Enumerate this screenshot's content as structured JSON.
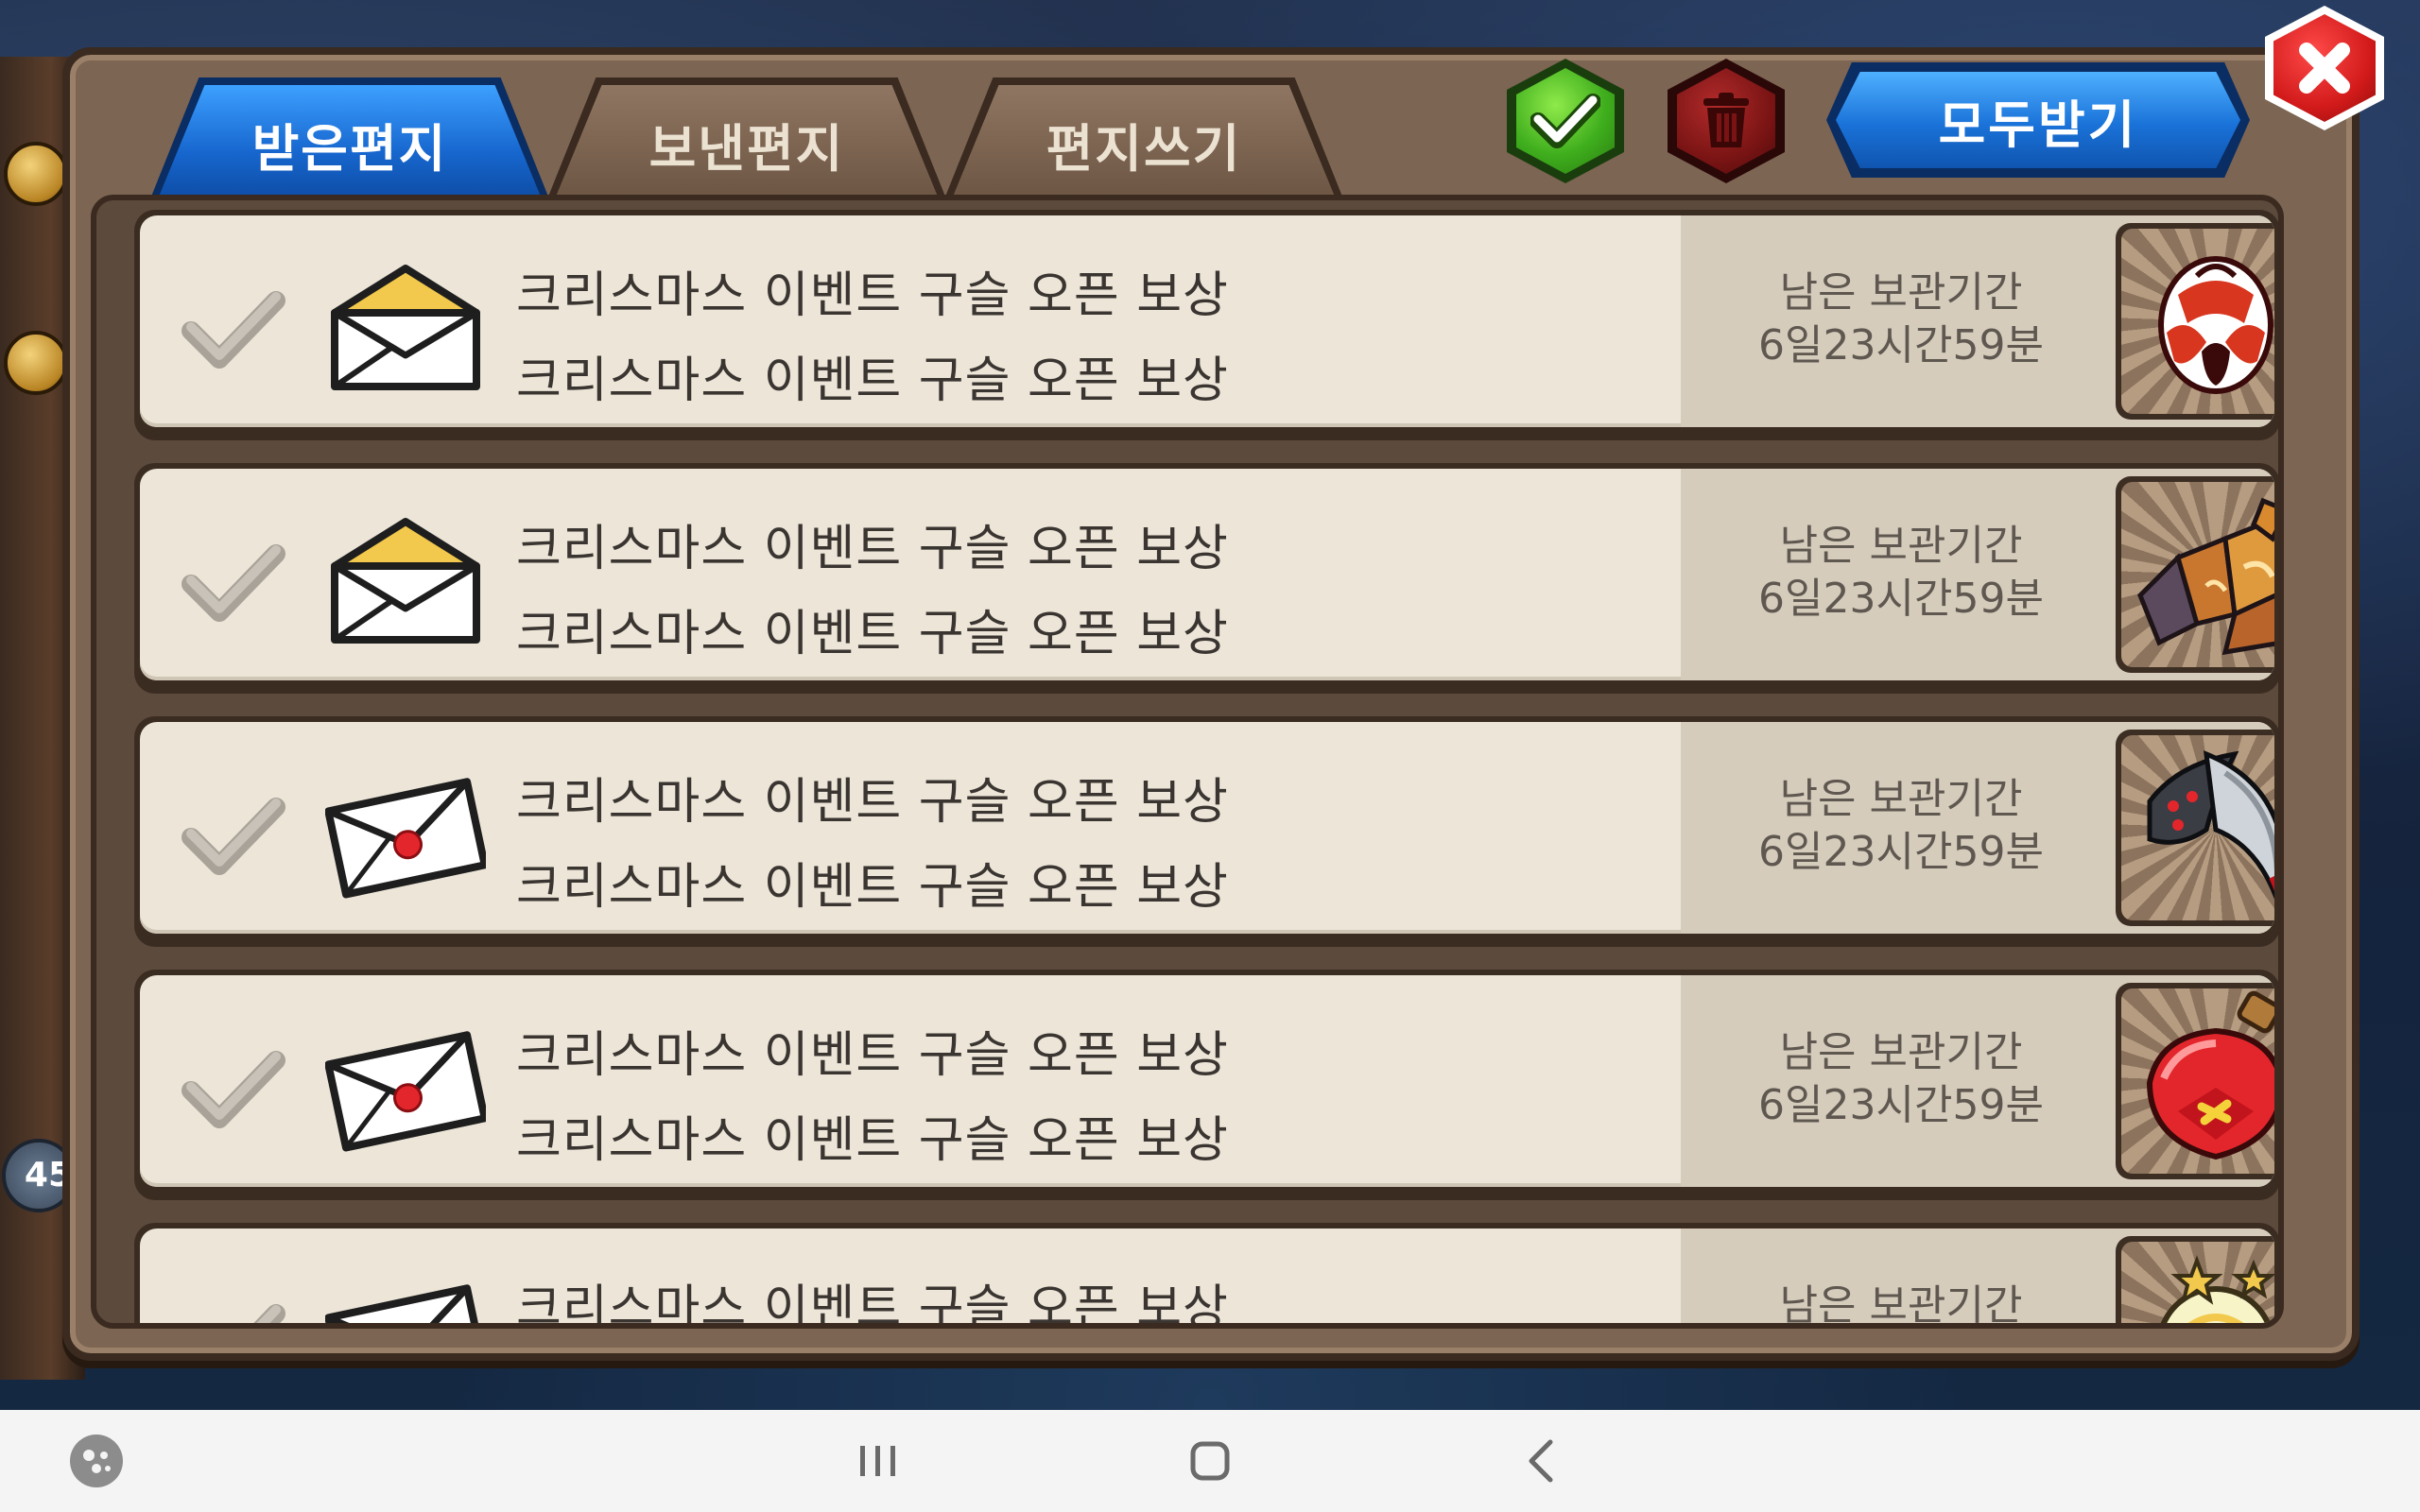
{
  "game_bg": {
    "level_badge": "45"
  },
  "tabs": [
    {
      "label": "받은편지",
      "active": true
    },
    {
      "label": "보낸편지",
      "active": false
    },
    {
      "label": "편지쓰기",
      "active": false
    }
  ],
  "toolbar": {
    "receive_all_label": "모두받기"
  },
  "mails": [
    {
      "line1": "크리스마스 이벤트 구슬 오픈 보상",
      "line2": "크리스마스 이벤트 구슬 오픈 보상",
      "expire_label": "남은 보관기간",
      "expire_value": "6일23시간59분",
      "envelope": "opened",
      "reward": "red-egg"
    },
    {
      "line1": "크리스마스 이벤트 구슬 오픈 보상",
      "line2": "크리스마스 이벤트 구슬 오픈 보상",
      "expire_label": "남은 보관기간",
      "expire_value": "6일23시간59분",
      "envelope": "opened",
      "reward": "crystal-gauntlet"
    },
    {
      "line1": "크리스마스 이벤트 구슬 오픈 보상",
      "line2": "크리스마스 이벤트 구슬 오픈 보상",
      "expire_label": "남은 보관기간",
      "expire_value": "6일23시간59분",
      "envelope": "sealed",
      "reward": "claw-blade"
    },
    {
      "line1": "크리스마스 이벤트 구슬 오픈 보상",
      "line2": "크리스마스 이벤트 구슬 오픈 보상",
      "expire_label": "남은 보관기간",
      "expire_value": "6일23시간59분",
      "envelope": "sealed",
      "reward": "red-potion"
    },
    {
      "line1": "크리스마스 이벤트 구슬 오픈 보상",
      "line2": "",
      "expire_label": "남은 보관기간",
      "expire_value": "",
      "envelope": "sealed",
      "reward": "star-orb"
    }
  ],
  "navbar": {
    "icons": [
      "game-launcher-icon",
      "recent-apps-icon",
      "home-icon",
      "back-icon"
    ]
  }
}
